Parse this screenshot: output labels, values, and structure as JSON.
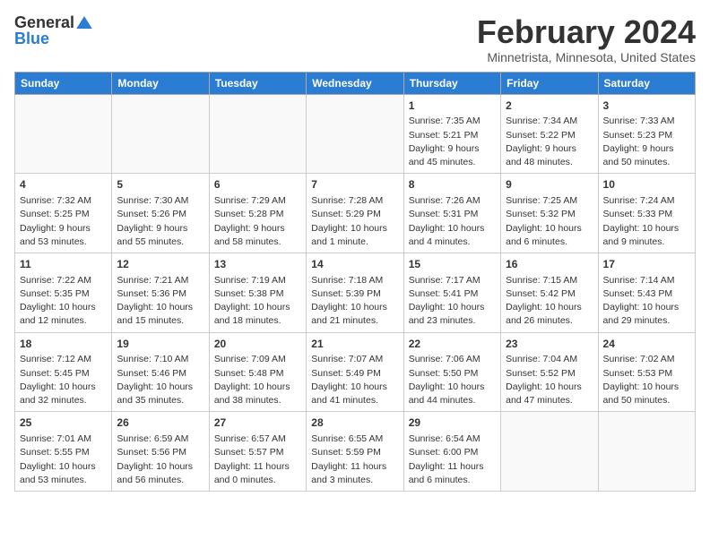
{
  "logo": {
    "general": "General",
    "blue": "Blue"
  },
  "title": "February 2024",
  "subtitle": "Minnetrista, Minnesota, United States",
  "days_of_week": [
    "Sunday",
    "Monday",
    "Tuesday",
    "Wednesday",
    "Thursday",
    "Friday",
    "Saturday"
  ],
  "weeks": [
    [
      {
        "day": "",
        "info": ""
      },
      {
        "day": "",
        "info": ""
      },
      {
        "day": "",
        "info": ""
      },
      {
        "day": "",
        "info": ""
      },
      {
        "day": "1",
        "info": "Sunrise: 7:35 AM\nSunset: 5:21 PM\nDaylight: 9 hours\nand 45 minutes."
      },
      {
        "day": "2",
        "info": "Sunrise: 7:34 AM\nSunset: 5:22 PM\nDaylight: 9 hours\nand 48 minutes."
      },
      {
        "day": "3",
        "info": "Sunrise: 7:33 AM\nSunset: 5:23 PM\nDaylight: 9 hours\nand 50 minutes."
      }
    ],
    [
      {
        "day": "4",
        "info": "Sunrise: 7:32 AM\nSunset: 5:25 PM\nDaylight: 9 hours\nand 53 minutes."
      },
      {
        "day": "5",
        "info": "Sunrise: 7:30 AM\nSunset: 5:26 PM\nDaylight: 9 hours\nand 55 minutes."
      },
      {
        "day": "6",
        "info": "Sunrise: 7:29 AM\nSunset: 5:28 PM\nDaylight: 9 hours\nand 58 minutes."
      },
      {
        "day": "7",
        "info": "Sunrise: 7:28 AM\nSunset: 5:29 PM\nDaylight: 10 hours\nand 1 minute."
      },
      {
        "day": "8",
        "info": "Sunrise: 7:26 AM\nSunset: 5:31 PM\nDaylight: 10 hours\nand 4 minutes."
      },
      {
        "day": "9",
        "info": "Sunrise: 7:25 AM\nSunset: 5:32 PM\nDaylight: 10 hours\nand 6 minutes."
      },
      {
        "day": "10",
        "info": "Sunrise: 7:24 AM\nSunset: 5:33 PM\nDaylight: 10 hours\nand 9 minutes."
      }
    ],
    [
      {
        "day": "11",
        "info": "Sunrise: 7:22 AM\nSunset: 5:35 PM\nDaylight: 10 hours\nand 12 minutes."
      },
      {
        "day": "12",
        "info": "Sunrise: 7:21 AM\nSunset: 5:36 PM\nDaylight: 10 hours\nand 15 minutes."
      },
      {
        "day": "13",
        "info": "Sunrise: 7:19 AM\nSunset: 5:38 PM\nDaylight: 10 hours\nand 18 minutes."
      },
      {
        "day": "14",
        "info": "Sunrise: 7:18 AM\nSunset: 5:39 PM\nDaylight: 10 hours\nand 21 minutes."
      },
      {
        "day": "15",
        "info": "Sunrise: 7:17 AM\nSunset: 5:41 PM\nDaylight: 10 hours\nand 23 minutes."
      },
      {
        "day": "16",
        "info": "Sunrise: 7:15 AM\nSunset: 5:42 PM\nDaylight: 10 hours\nand 26 minutes."
      },
      {
        "day": "17",
        "info": "Sunrise: 7:14 AM\nSunset: 5:43 PM\nDaylight: 10 hours\nand 29 minutes."
      }
    ],
    [
      {
        "day": "18",
        "info": "Sunrise: 7:12 AM\nSunset: 5:45 PM\nDaylight: 10 hours\nand 32 minutes."
      },
      {
        "day": "19",
        "info": "Sunrise: 7:10 AM\nSunset: 5:46 PM\nDaylight: 10 hours\nand 35 minutes."
      },
      {
        "day": "20",
        "info": "Sunrise: 7:09 AM\nSunset: 5:48 PM\nDaylight: 10 hours\nand 38 minutes."
      },
      {
        "day": "21",
        "info": "Sunrise: 7:07 AM\nSunset: 5:49 PM\nDaylight: 10 hours\nand 41 minutes."
      },
      {
        "day": "22",
        "info": "Sunrise: 7:06 AM\nSunset: 5:50 PM\nDaylight: 10 hours\nand 44 minutes."
      },
      {
        "day": "23",
        "info": "Sunrise: 7:04 AM\nSunset: 5:52 PM\nDaylight: 10 hours\nand 47 minutes."
      },
      {
        "day": "24",
        "info": "Sunrise: 7:02 AM\nSunset: 5:53 PM\nDaylight: 10 hours\nand 50 minutes."
      }
    ],
    [
      {
        "day": "25",
        "info": "Sunrise: 7:01 AM\nSunset: 5:55 PM\nDaylight: 10 hours\nand 53 minutes."
      },
      {
        "day": "26",
        "info": "Sunrise: 6:59 AM\nSunset: 5:56 PM\nDaylight: 10 hours\nand 56 minutes."
      },
      {
        "day": "27",
        "info": "Sunrise: 6:57 AM\nSunset: 5:57 PM\nDaylight: 11 hours\nand 0 minutes."
      },
      {
        "day": "28",
        "info": "Sunrise: 6:55 AM\nSunset: 5:59 PM\nDaylight: 11 hours\nand 3 minutes."
      },
      {
        "day": "29",
        "info": "Sunrise: 6:54 AM\nSunset: 6:00 PM\nDaylight: 11 hours\nand 6 minutes."
      },
      {
        "day": "",
        "info": ""
      },
      {
        "day": "",
        "info": ""
      }
    ]
  ]
}
